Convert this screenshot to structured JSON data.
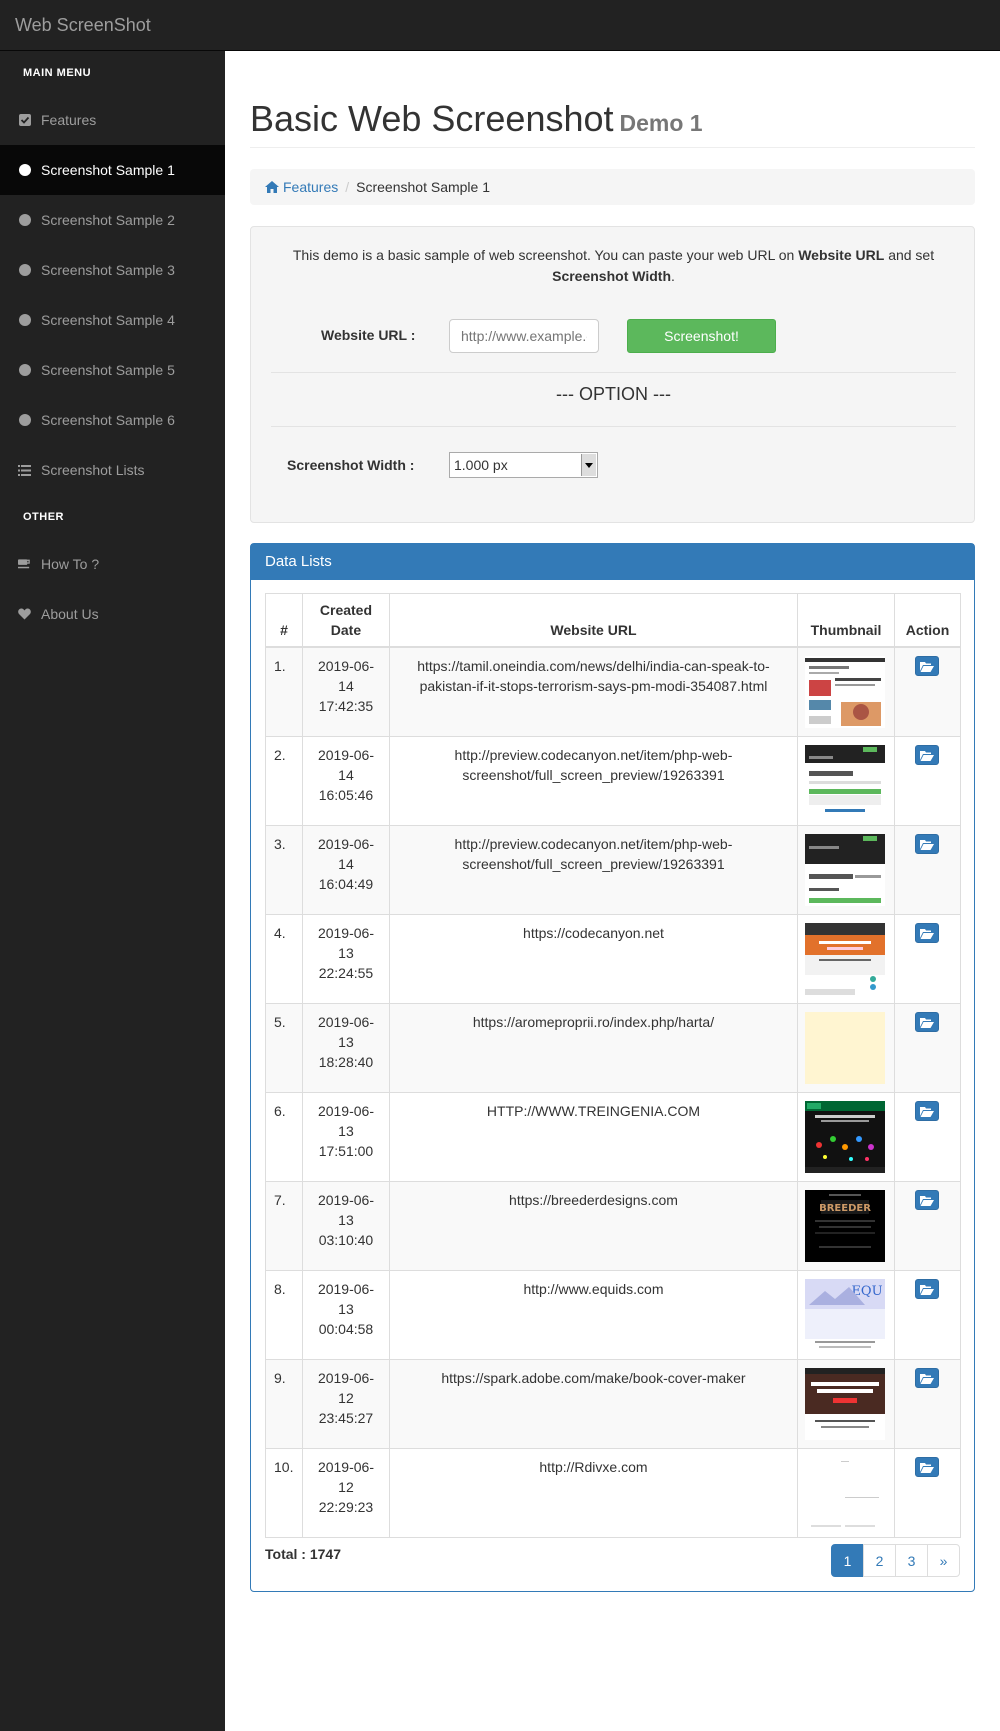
{
  "app": {
    "brand": "Web ScreenShot"
  },
  "sidebar": {
    "main_heading": "MAIN MENU",
    "other_heading": "OTHER",
    "items": [
      {
        "label": "Features",
        "icon": "check-square-icon"
      },
      {
        "label": "Screenshot Sample 1",
        "icon": "circle-icon",
        "active": true
      },
      {
        "label": "Screenshot Sample 2",
        "icon": "circle-icon"
      },
      {
        "label": "Screenshot Sample 3",
        "icon": "circle-icon"
      },
      {
        "label": "Screenshot Sample 4",
        "icon": "circle-icon"
      },
      {
        "label": "Screenshot Sample 5",
        "icon": "circle-icon"
      },
      {
        "label": "Screenshot Sample 6",
        "icon": "circle-icon"
      },
      {
        "label": "Screenshot Lists",
        "icon": "list-icon"
      }
    ],
    "other_items": [
      {
        "label": "How To ?",
        "icon": "coffee-icon"
      },
      {
        "label": "About Us",
        "icon": "heart-icon"
      }
    ]
  },
  "page": {
    "title": "Basic Web Screenshot",
    "subtitle": "Demo 1",
    "breadcrumb": {
      "home": "Features",
      "current": "Screenshot Sample 1"
    }
  },
  "form": {
    "intro_pre": "This demo is a basic sample of web screenshot. You can paste your web URL on",
    "intro_bold1": "Website URL",
    "intro_mid": "and set",
    "intro_bold2": "Screenshot Width",
    "intro_end": ".",
    "url_label": "Website URL :",
    "url_placeholder": "http://www.example.com",
    "button": "Screenshot!",
    "option_heading": "--- OPTION ---",
    "width_label": "Screenshot Width :",
    "width_value": "1.000 px"
  },
  "panel": {
    "title": "Data Lists",
    "columns": [
      "#",
      "Created Date",
      "Website URL",
      "Thumbnail",
      "Action"
    ],
    "rows": [
      {
        "num": "1.",
        "date_a": "2019-06-",
        "date_b": "14",
        "date_c": "17:42:35",
        "url": "https://tamil.oneindia.com/news/delhi/india-can-speak-to-pakistan-if-it-stops-terrorism-says-pm-modi-354087.html",
        "thumb": "news"
      },
      {
        "num": "2.",
        "date_a": "2019-06-",
        "date_b": "14",
        "date_c": "16:05:46",
        "url": "http://preview.codecanyon.net/item/php-web-screenshot/full_screen_preview/19263391",
        "thumb": "features"
      },
      {
        "num": "3.",
        "date_a": "2019-06-",
        "date_b": "14",
        "date_c": "16:04:49",
        "url": "http://preview.codecanyon.net/item/php-web-screenshot/full_screen_preview/19263391",
        "thumb": "features2"
      },
      {
        "num": "4.",
        "date_a": "2019-06-",
        "date_b": "13",
        "date_c": "22:24:55",
        "url": "https://codecanyon.net",
        "thumb": "orange"
      },
      {
        "num": "5.",
        "date_a": "2019-06-",
        "date_b": "13",
        "date_c": "18:28:40",
        "url": "https://aromeproprii.ro/index.php/harta/",
        "thumb": "cream"
      },
      {
        "num": "6.",
        "date_a": "2019-06-",
        "date_b": "13",
        "date_c": "17:51:00",
        "url": "HTTP://WWW.TREINGENIA.COM",
        "thumb": "dark"
      },
      {
        "num": "7.",
        "date_a": "2019-06-",
        "date_b": "13",
        "date_c": "03:10:40",
        "url": "https://breederdesigns.com",
        "thumb": "black"
      },
      {
        "num": "8.",
        "date_a": "2019-06-",
        "date_b": "13",
        "date_c": "00:04:58",
        "url": "http://www.equids.com",
        "thumb": "equids"
      },
      {
        "num": "9.",
        "date_a": "2019-06-",
        "date_b": "12",
        "date_c": "23:45:27",
        "url": "https://spark.adobe.com/make/book-cover-maker",
        "thumb": "adobe"
      },
      {
        "num": "10.",
        "date_a": "2019-06-",
        "date_b": "12",
        "date_c": "22:29:23",
        "url": "http://Rdivxe.com",
        "thumb": "blank"
      }
    ],
    "total": "Total : 1747",
    "pages": [
      "1",
      "2",
      "3",
      "»"
    ]
  },
  "colors": {
    "primary": "#337ab7",
    "success": "#5cb85c",
    "sidebar": "#222222"
  }
}
